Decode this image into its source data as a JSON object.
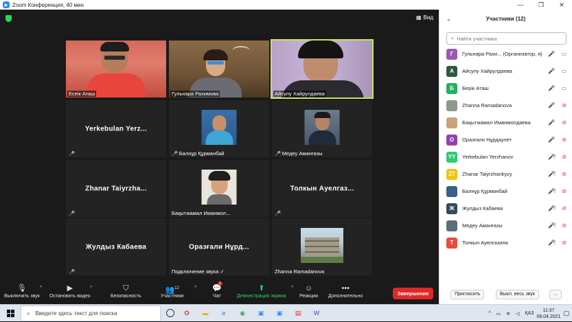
{
  "window": {
    "title": "Zoom Конференция, 40 мин",
    "controls": [
      "—",
      "❐",
      "✕"
    ]
  },
  "meeting": {
    "view_label": "Вид",
    "tiles": [
      {
        "name": "Есеік Аташ",
        "type": "video"
      },
      {
        "name": "Гульнара Рахимова",
        "type": "video"
      },
      {
        "name": "Айсулу Хайрулдаева",
        "type": "video",
        "active": true
      },
      {
        "name": "Yerkebulan  Yerz...",
        "type": "name"
      },
      {
        "name": "Балнұр Құрманбай",
        "type": "photo",
        "muted": true
      },
      {
        "name": "Медеу Аманғазы",
        "type": "photo",
        "muted": true
      },
      {
        "name": "Zhanar  Taiyrzha...",
        "type": "name"
      },
      {
        "name": "Бақытжамал Иманмол...",
        "type": "photo"
      },
      {
        "name": "Толкын  Ауелгаз...",
        "type": "name"
      },
      {
        "name": "Жулдыз Кабаева",
        "type": "name"
      },
      {
        "name": "Оразғали  Нұрд...",
        "type": "name"
      },
      {
        "name": "Zhanna Ramadanova",
        "type": "photo"
      }
    ],
    "audio_connecting": "Подключение звука ✓"
  },
  "toolbar": {
    "mute": "Выключить звук",
    "video": "Остановить видео",
    "security": "Безопасность",
    "participants": "Участники",
    "participants_count": "12",
    "chat": "Чат",
    "chat_badge": "1",
    "share": "Демонстрация экрана",
    "reactions": "Реакции",
    "more": "Дополнительно",
    "end": "Завершение"
  },
  "panel": {
    "title": "Участники (12)",
    "search_placeholder": "Найти участника",
    "participants": [
      {
        "initial": "Г",
        "color": "#9b59b6",
        "name": "Гульнара Рахи...  (Организатор, я)",
        "mic": "on",
        "cam": "on"
      },
      {
        "initial": "А",
        "color": "#2d5a3d",
        "name": "Айсулу Хайрулдаева",
        "mic": "on",
        "cam": "on"
      },
      {
        "initial": "Б",
        "color": "#27ae60",
        "name": "Берік Аташ",
        "mic": "on",
        "cam": "on"
      },
      {
        "initial": "",
        "color": "#8c9a8a",
        "name": "Zhanna Ramadanova",
        "mic": "on",
        "cam": "off"
      },
      {
        "initial": "",
        "color": "#c9a27e",
        "name": "Бақытжамал Иманмолдаева",
        "mic": "on",
        "cam": "off"
      },
      {
        "initial": "О",
        "color": "#8e44ad",
        "name": "Оразғали Нұрдаулет",
        "mic": "on",
        "cam": "off"
      },
      {
        "initial": "YY",
        "color": "#2ecc71",
        "name": "Yerkebulan Yerzhanov",
        "mic": "off",
        "cam": "off"
      },
      {
        "initial": "ZT",
        "color": "#f1c40f",
        "name": "Zhanar Taiyrzhankyzy",
        "mic": "off",
        "cam": "off"
      },
      {
        "initial": "",
        "color": "#3a5f8a",
        "name": "Балнұр Құрманбай",
        "mic": "off",
        "cam": "off"
      },
      {
        "initial": "Ж",
        "color": "#34495e",
        "name": "Жулдыз Кабаева",
        "mic": "off",
        "cam": "off"
      },
      {
        "initial": "",
        "color": "#5d6d7e",
        "name": "Медеу Аманғазы",
        "mic": "off",
        "cam": "off"
      },
      {
        "initial": "Т",
        "color": "#e74c3c",
        "name": "Толкын Ауелгазина",
        "mic": "off",
        "cam": "off"
      }
    ],
    "invite": "Пригласить",
    "mute_all": "Выкл. весь звук",
    "more": "..."
  },
  "taskbar": {
    "search_placeholder": "Введите здесь текст для поиска",
    "lang": "ҚАЗ",
    "time": "11:37",
    "date": "08.04.2021"
  }
}
